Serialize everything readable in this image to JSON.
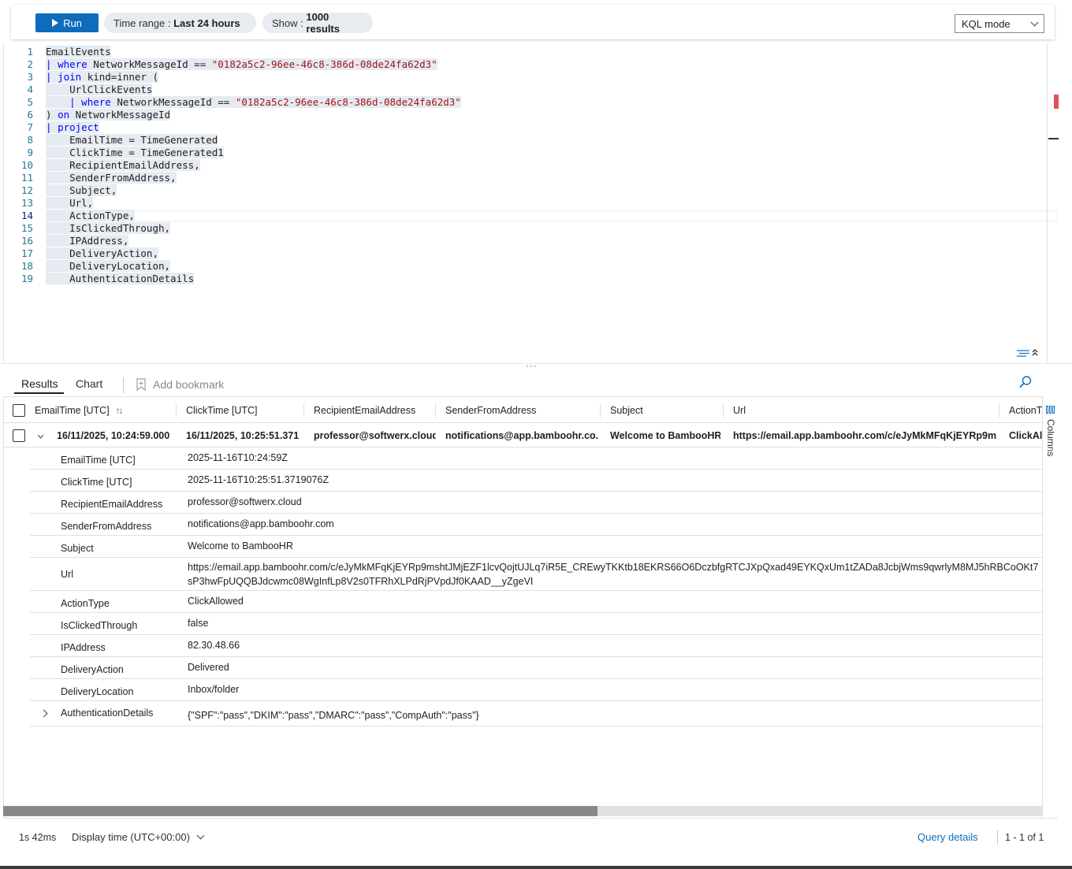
{
  "toolbar": {
    "run_label": "Run",
    "time_range_label": "Time range : ",
    "time_range_value": "Last 24 hours",
    "show_label": "Show : ",
    "show_value": "1000 results",
    "mode": "KQL mode"
  },
  "editor": {
    "line_numbers": [
      "1",
      "2",
      "3",
      "4",
      "5",
      "6",
      "7",
      "8",
      "9",
      "10",
      "11",
      "12",
      "13",
      "14",
      "15",
      "16",
      "17",
      "18",
      "19"
    ],
    "active_line": 14,
    "lines": [
      "EmailEvents",
      "| where NetworkMessageId == \"0182a5c2-96ee-46c8-386d-08de24fa62d3\"",
      "| join kind=inner (",
      "    UrlClickEvents",
      "    | where NetworkMessageId == \"0182a5c2-96ee-46c8-386d-08de24fa62d3\"",
      ") on NetworkMessageId",
      "| project",
      "    EmailTime = TimeGenerated",
      "    ClickTime = TimeGenerated1",
      "    RecipientEmailAddress,",
      "    SenderFromAddress,",
      "    Subject,",
      "    Url,",
      "    ActionType,",
      "    IsClickedThrough,",
      "    IPAddress,",
      "    DeliveryAction,",
      "    DeliveryLocation,",
      "    AuthenticationDetails"
    ],
    "tokens": {
      "where": "where",
      "join": "join",
      "kind_inner": " kind=inner (",
      "on": "on",
      "project": "project",
      "network_message_id": "NetworkMessageId",
      "eq": " == ",
      "id_string": "\"0182a5c2-96ee-46c8-386d-08de24fa62d3\"",
      "pipe": "|",
      "close_paren": ")"
    }
  },
  "results": {
    "tabs": {
      "results": "Results",
      "chart": "Chart",
      "bookmark": "Add bookmark"
    },
    "columns": [
      "EmailTime [UTC]",
      "ClickTime [UTC]",
      "RecipientEmailAddress",
      "SenderFromAddress",
      "Subject",
      "Url",
      "ActionT"
    ],
    "row": {
      "email_time": "16/11/2025, 10:24:59.000",
      "click_time": "16/11/2025, 10:25:51.371",
      "recipient": "professor@softwerx.cloud",
      "sender": "notifications@app.bamboohr.co...",
      "subject": "Welcome to BambooHR",
      "url": "https://email.app.bamboohr.com/c/eJyMkMFqKjEYRp9ms...",
      "action": "ClickAll"
    },
    "details": [
      {
        "key": "EmailTime [UTC]",
        "value": "2025-11-16T10:24:59Z"
      },
      {
        "key": "ClickTime [UTC]",
        "value": "2025-11-16T10:25:51.3719076Z"
      },
      {
        "key": "RecipientEmailAddress",
        "value": "professor@softwerx.cloud"
      },
      {
        "key": "SenderFromAddress",
        "value": "notifications@app.bamboohr.com"
      },
      {
        "key": "Subject",
        "value": "Welcome to BambooHR"
      },
      {
        "key": "Url",
        "value": "https://email.app.bamboohr.com/c/eJyMkMFqKjEYRp9mshtJMjEZF1lcvQojtUJLq7iR5E_CREwyTKKtb18EKRS66O6DczbfgRTCJXpQxad49EYKQxUm1tZADa8JcbjWms9qwrlyM8MJ5hRBCoOKt7sP3hwFpUQQBJdcwmc08WgInfLp8V2s0TFRhXLPdRjPVpdJf0KAAD__yZgeVI"
      },
      {
        "key": "ActionType",
        "value": "ClickAllowed"
      },
      {
        "key": "IsClickedThrough",
        "value": "false"
      },
      {
        "key": "IPAddress",
        "value": "82.30.48.66"
      },
      {
        "key": "DeliveryAction",
        "value": "Delivered"
      },
      {
        "key": "DeliveryLocation",
        "value": "Inbox/folder"
      },
      {
        "key": "AuthenticationDetails",
        "value": "{\"SPF\":\"pass\",\"DKIM\":\"pass\",\"DMARC\":\"pass\",\"CompAuth\":\"pass\"}"
      }
    ],
    "columns_panel_label": "Columns"
  },
  "footer": {
    "duration": "1s 42ms",
    "display_time": "Display time (UTC+00:00)",
    "query_details": "Query details",
    "pages": "1 - 1 of 1"
  },
  "colors": {
    "accent": "#0f6cbd",
    "keyword": "#0000ff",
    "string": "#a31515",
    "line_number": "#237893"
  }
}
